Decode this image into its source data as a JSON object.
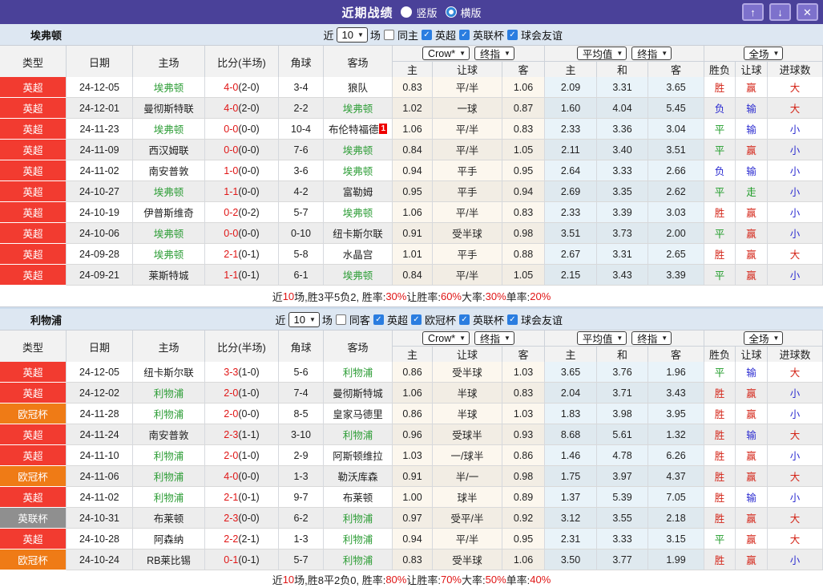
{
  "titlebar": {
    "title": "近期战绩",
    "radios": [
      {
        "label": "竖版",
        "selected": false
      },
      {
        "label": "横版",
        "selected": true
      }
    ],
    "buttons": [
      {
        "icon": "arrow-up",
        "glyph": "↑"
      },
      {
        "icon": "arrow-down",
        "glyph": "↓"
      },
      {
        "icon": "close",
        "glyph": "✕"
      }
    ]
  },
  "colors": {
    "league": {
      "英超": "#f23b30",
      "欧冠杯": "#ef7b16",
      "英联杯": "#8f8f8f"
    },
    "result": {
      "胜": "#d42518",
      "平": "#1b9a24",
      "负": "#2b2bd0",
      "赢": "#d42518",
      "输": "#2b2bd0",
      "走": "#1b9a24",
      "大": "#d42518",
      "小": "#2b2bd0"
    }
  },
  "table_headers": {
    "left": [
      "类型",
      "日期",
      "主场",
      "比分(半场)",
      "角球",
      "客场"
    ],
    "sub": [
      "主",
      "让球",
      "客",
      "主",
      "和",
      "客",
      "胜负",
      "让球",
      "进球数"
    ]
  },
  "sections": [
    {
      "team": "埃弗顿",
      "controls": {
        "near": "近",
        "count": "10",
        "games": "场",
        "same_label": "同主",
        "same_checked": false,
        "leagues": [
          {
            "label": "英超",
            "checked": true
          },
          {
            "label": "英联杯",
            "checked": true
          },
          {
            "label": "球会友谊",
            "checked": true
          }
        ]
      },
      "dropdowns": {
        "odds_src": "Crow*",
        "odds_mode": "终指",
        "avg_src": "平均值",
        "avg_mode": "终指",
        "scope": "全场"
      },
      "rows": [
        {
          "league": "英超",
          "date": "24-12-05",
          "home": "埃弗顿",
          "home_hl": true,
          "ft": "4-0",
          "ht": "(2-0)",
          "corner": "3-4",
          "away": "狼队",
          "away_hl": false,
          "away_badge": null,
          "odds": [
            "0.83",
            "平/半",
            "1.06"
          ],
          "avg": [
            "2.09",
            "3.31",
            "3.65"
          ],
          "results": [
            "胜",
            "赢",
            "大"
          ]
        },
        {
          "league": "英超",
          "date": "24-12-01",
          "home": "曼彻斯特联",
          "home_hl": false,
          "ft": "4-0",
          "ht": "(2-0)",
          "corner": "2-2",
          "away": "埃弗顿",
          "away_hl": true,
          "away_badge": null,
          "odds": [
            "1.02",
            "一球",
            "0.87"
          ],
          "avg": [
            "1.60",
            "4.04",
            "5.45"
          ],
          "results": [
            "负",
            "输",
            "大"
          ]
        },
        {
          "league": "英超",
          "date": "24-11-23",
          "home": "埃弗顿",
          "home_hl": true,
          "ft": "0-0",
          "ht": "(0-0)",
          "corner": "10-4",
          "away": "布伦特福德",
          "away_hl": false,
          "away_badge": "1",
          "odds": [
            "1.06",
            "平/半",
            "0.83"
          ],
          "avg": [
            "2.33",
            "3.36",
            "3.04"
          ],
          "results": [
            "平",
            "输",
            "小"
          ]
        },
        {
          "league": "英超",
          "date": "24-11-09",
          "home": "西汉姆联",
          "home_hl": false,
          "ft": "0-0",
          "ht": "(0-0)",
          "corner": "7-6",
          "away": "埃弗顿",
          "away_hl": true,
          "away_badge": null,
          "odds": [
            "0.84",
            "平/半",
            "1.05"
          ],
          "avg": [
            "2.11",
            "3.40",
            "3.51"
          ],
          "results": [
            "平",
            "赢",
            "小"
          ]
        },
        {
          "league": "英超",
          "date": "24-11-02",
          "home": "南安普敦",
          "home_hl": false,
          "ft": "1-0",
          "ht": "(0-0)",
          "corner": "3-6",
          "away": "埃弗顿",
          "away_hl": true,
          "away_badge": null,
          "odds": [
            "0.94",
            "平手",
            "0.95"
          ],
          "avg": [
            "2.64",
            "3.33",
            "2.66"
          ],
          "results": [
            "负",
            "输",
            "小"
          ]
        },
        {
          "league": "英超",
          "date": "24-10-27",
          "home": "埃弗顿",
          "home_hl": true,
          "ft": "1-1",
          "ht": "(0-0)",
          "corner": "4-2",
          "away": "富勒姆",
          "away_hl": false,
          "away_badge": null,
          "odds": [
            "0.95",
            "平手",
            "0.94"
          ],
          "avg": [
            "2.69",
            "3.35",
            "2.62"
          ],
          "results": [
            "平",
            "走",
            "小"
          ]
        },
        {
          "league": "英超",
          "date": "24-10-19",
          "home": "伊普斯维奇",
          "home_hl": false,
          "ft": "0-2",
          "ht": "(0-2)",
          "corner": "5-7",
          "away": "埃弗顿",
          "away_hl": true,
          "away_badge": null,
          "odds": [
            "1.06",
            "平/半",
            "0.83"
          ],
          "avg": [
            "2.33",
            "3.39",
            "3.03"
          ],
          "results": [
            "胜",
            "赢",
            "小"
          ]
        },
        {
          "league": "英超",
          "date": "24-10-06",
          "home": "埃弗顿",
          "home_hl": true,
          "ft": "0-0",
          "ht": "(0-0)",
          "corner": "0-10",
          "away": "纽卡斯尔联",
          "away_hl": false,
          "away_badge": null,
          "odds": [
            "0.91",
            "受半球",
            "0.98"
          ],
          "avg": [
            "3.51",
            "3.73",
            "2.00"
          ],
          "results": [
            "平",
            "赢",
            "小"
          ]
        },
        {
          "league": "英超",
          "date": "24-09-28",
          "home": "埃弗顿",
          "home_hl": true,
          "ft": "2-1",
          "ht": "(0-1)",
          "corner": "5-8",
          "away": "水晶宫",
          "away_hl": false,
          "away_badge": null,
          "odds": [
            "1.01",
            "平手",
            "0.88"
          ],
          "avg": [
            "2.67",
            "3.31",
            "2.65"
          ],
          "results": [
            "胜",
            "赢",
            "大"
          ]
        },
        {
          "league": "英超",
          "date": "24-09-21",
          "home": "莱斯特城",
          "home_hl": false,
          "ft": "1-1",
          "ht": "(0-1)",
          "corner": "6-1",
          "away": "埃弗顿",
          "away_hl": true,
          "away_badge": null,
          "odds": [
            "0.84",
            "平/半",
            "1.05"
          ],
          "avg": [
            "2.15",
            "3.43",
            "3.39"
          ],
          "results": [
            "平",
            "赢",
            "小"
          ]
        }
      ],
      "summary": [
        {
          "t": "近"
        },
        {
          "t": "10",
          "red": true
        },
        {
          "t": "场,胜3平5负2, 胜率:"
        },
        {
          "t": "30%",
          "red": true
        },
        {
          "t": " 让胜率:"
        },
        {
          "t": "60%",
          "red": true
        },
        {
          "t": " 大率:"
        },
        {
          "t": "30%",
          "red": true
        },
        {
          "t": " 单率:"
        },
        {
          "t": "20%",
          "red": true
        }
      ]
    },
    {
      "team": "利物浦",
      "controls": {
        "near": "近",
        "count": "10",
        "games": "场",
        "same_label": "同客",
        "same_checked": false,
        "leagues": [
          {
            "label": "英超",
            "checked": true
          },
          {
            "label": "欧冠杯",
            "checked": true
          },
          {
            "label": "英联杯",
            "checked": true
          },
          {
            "label": "球会友谊",
            "checked": true
          }
        ]
      },
      "dropdowns": {
        "odds_src": "Crow*",
        "odds_mode": "终指",
        "avg_src": "平均值",
        "avg_mode": "终指",
        "scope": "全场"
      },
      "rows": [
        {
          "league": "英超",
          "date": "24-12-05",
          "home": "纽卡斯尔联",
          "home_hl": false,
          "ft": "3-3",
          "ht": "(1-0)",
          "corner": "5-6",
          "away": "利物浦",
          "away_hl": true,
          "away_badge": null,
          "odds": [
            "0.86",
            "受半球",
            "1.03"
          ],
          "avg": [
            "3.65",
            "3.76",
            "1.96"
          ],
          "results": [
            "平",
            "输",
            "大"
          ]
        },
        {
          "league": "英超",
          "date": "24-12-02",
          "home": "利物浦",
          "home_hl": true,
          "ft": "2-0",
          "ht": "(1-0)",
          "corner": "7-4",
          "away": "曼彻斯特城",
          "away_hl": false,
          "away_badge": null,
          "odds": [
            "1.06",
            "半球",
            "0.83"
          ],
          "avg": [
            "2.04",
            "3.71",
            "3.43"
          ],
          "results": [
            "胜",
            "赢",
            "小"
          ]
        },
        {
          "league": "欧冠杯",
          "date": "24-11-28",
          "home": "利物浦",
          "home_hl": true,
          "ft": "2-0",
          "ht": "(0-0)",
          "corner": "8-5",
          "away": "皇家马德里",
          "away_hl": false,
          "away_badge": null,
          "odds": [
            "0.86",
            "半球",
            "1.03"
          ],
          "avg": [
            "1.83",
            "3.98",
            "3.95"
          ],
          "results": [
            "胜",
            "赢",
            "小"
          ]
        },
        {
          "league": "英超",
          "date": "24-11-24",
          "home": "南安普敦",
          "home_hl": false,
          "ft": "2-3",
          "ht": "(1-1)",
          "corner": "3-10",
          "away": "利物浦",
          "away_hl": true,
          "away_badge": null,
          "odds": [
            "0.96",
            "受球半",
            "0.93"
          ],
          "avg": [
            "8.68",
            "5.61",
            "1.32"
          ],
          "results": [
            "胜",
            "输",
            "大"
          ]
        },
        {
          "league": "英超",
          "date": "24-11-10",
          "home": "利物浦",
          "home_hl": true,
          "ft": "2-0",
          "ht": "(1-0)",
          "corner": "2-9",
          "away": "阿斯顿维拉",
          "away_hl": false,
          "away_badge": null,
          "odds": [
            "1.03",
            "一/球半",
            "0.86"
          ],
          "avg": [
            "1.46",
            "4.78",
            "6.26"
          ],
          "results": [
            "胜",
            "赢",
            "小"
          ]
        },
        {
          "league": "欧冠杯",
          "date": "24-11-06",
          "home": "利物浦",
          "home_hl": true,
          "ft": "4-0",
          "ht": "(0-0)",
          "corner": "1-3",
          "away": "勒沃库森",
          "away_hl": false,
          "away_badge": null,
          "odds": [
            "0.91",
            "半/一",
            "0.98"
          ],
          "avg": [
            "1.75",
            "3.97",
            "4.37"
          ],
          "results": [
            "胜",
            "赢",
            "大"
          ]
        },
        {
          "league": "英超",
          "date": "24-11-02",
          "home": "利物浦",
          "home_hl": true,
          "ft": "2-1",
          "ht": "(0-1)",
          "corner": "9-7",
          "away": "布莱顿",
          "away_hl": false,
          "away_badge": null,
          "odds": [
            "1.00",
            "球半",
            "0.89"
          ],
          "avg": [
            "1.37",
            "5.39",
            "7.05"
          ],
          "results": [
            "胜",
            "输",
            "小"
          ]
        },
        {
          "league": "英联杯",
          "date": "24-10-31",
          "home": "布莱顿",
          "home_hl": false,
          "ft": "2-3",
          "ht": "(0-0)",
          "corner": "6-2",
          "away": "利物浦",
          "away_hl": true,
          "away_badge": null,
          "odds": [
            "0.97",
            "受平/半",
            "0.92"
          ],
          "avg": [
            "3.12",
            "3.55",
            "2.18"
          ],
          "results": [
            "胜",
            "赢",
            "大"
          ]
        },
        {
          "league": "英超",
          "date": "24-10-28",
          "home": "阿森纳",
          "home_hl": false,
          "ft": "2-2",
          "ht": "(2-1)",
          "corner": "1-3",
          "away": "利物浦",
          "away_hl": true,
          "away_badge": null,
          "odds": [
            "0.94",
            "平/半",
            "0.95"
          ],
          "avg": [
            "2.31",
            "3.33",
            "3.15"
          ],
          "results": [
            "平",
            "赢",
            "大"
          ]
        },
        {
          "league": "欧冠杯",
          "date": "24-10-24",
          "home": "RB莱比锡",
          "home_hl": false,
          "ft": "0-1",
          "ht": "(0-1)",
          "corner": "5-7",
          "away": "利物浦",
          "away_hl": true,
          "away_badge": null,
          "odds": [
            "0.83",
            "受半球",
            "1.06"
          ],
          "avg": [
            "3.50",
            "3.77",
            "1.99"
          ],
          "results": [
            "胜",
            "赢",
            "小"
          ]
        }
      ],
      "summary": [
        {
          "t": "近"
        },
        {
          "t": "10",
          "red": true
        },
        {
          "t": "场,胜8平2负0, 胜率:"
        },
        {
          "t": "80%",
          "red": true
        },
        {
          "t": " 让胜率:"
        },
        {
          "t": "70%",
          "red": true
        },
        {
          "t": " 大率:"
        },
        {
          "t": "50%",
          "red": true
        },
        {
          "t": " 单率:"
        },
        {
          "t": "40%",
          "red": true
        }
      ]
    }
  ]
}
